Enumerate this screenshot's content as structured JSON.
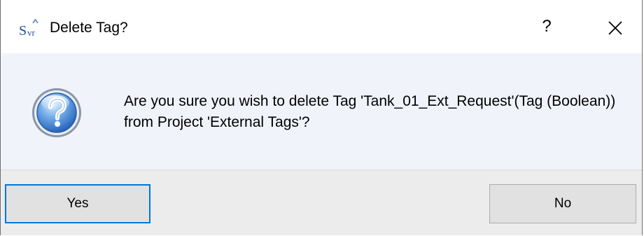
{
  "window": {
    "title": "Delete Tag?",
    "icon": "svr-app-icon",
    "help_label": "?",
    "close_icon": "close-icon"
  },
  "message": {
    "icon": "question-icon",
    "text": "Are you sure you wish to delete Tag 'Tank_01_Ext_Request'(Tag (Boolean)) from Project 'External Tags'?"
  },
  "buttons": {
    "yes_label": "Yes",
    "no_label": "No"
  },
  "colors": {
    "content_bg": "#f0f3f9",
    "footer_bg": "#ececec",
    "focus_border": "#0078d7",
    "button_bg": "#e1e1e1"
  }
}
